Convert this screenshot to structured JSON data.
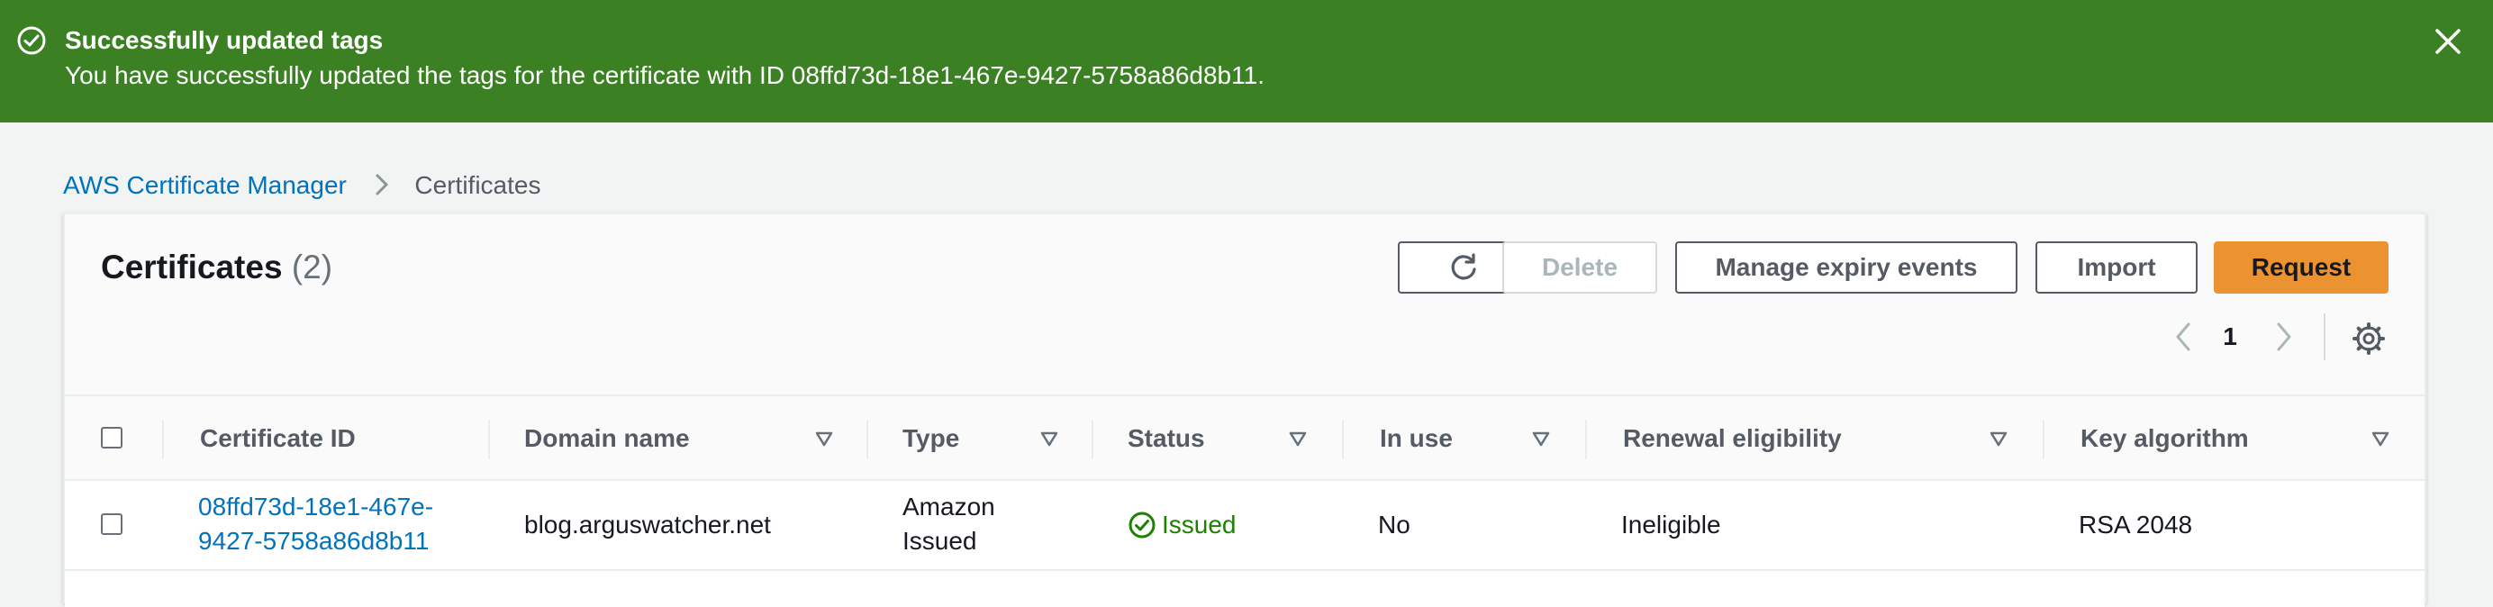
{
  "flash": {
    "title": "Successfully updated tags",
    "message": "You have successfully updated the tags for the certificate with ID 08ffd73d-18e1-467e-9427-5758a86d8b11.",
    "status_icon": "check-circle-icon",
    "close_icon": "close-icon"
  },
  "breadcrumb": {
    "root": "AWS Certificate Manager",
    "current": "Certificates"
  },
  "header": {
    "title": "Certificates",
    "count": "(2)"
  },
  "actions": {
    "refresh_icon": "refresh-icon",
    "delete": "Delete",
    "manage_expiry": "Manage expiry events",
    "import": "Import",
    "request": "Request"
  },
  "pagination": {
    "current_page": "1"
  },
  "table": {
    "columns": [
      "Certificate ID",
      "Domain name",
      "Type",
      "Status",
      "In use",
      "Renewal eligibility",
      "Key algorithm"
    ],
    "rows": [
      {
        "certificate_id_line1": "08ffd73d-18e1-467e-",
        "certificate_id_line2": "9427-5758a86d8b11",
        "domain_name": "blog.arguswatcher.net",
        "type_line1": "Amazon",
        "type_line2": "Issued",
        "status": "Issued",
        "in_use": "No",
        "renewal_eligibility": "Ineligible",
        "key_algorithm": "RSA 2048"
      }
    ]
  },
  "colors": {
    "success_banner": "#3b8124",
    "link": "#0073bb",
    "primary_button": "#ec9331",
    "status_issued": "#1d8102"
  }
}
